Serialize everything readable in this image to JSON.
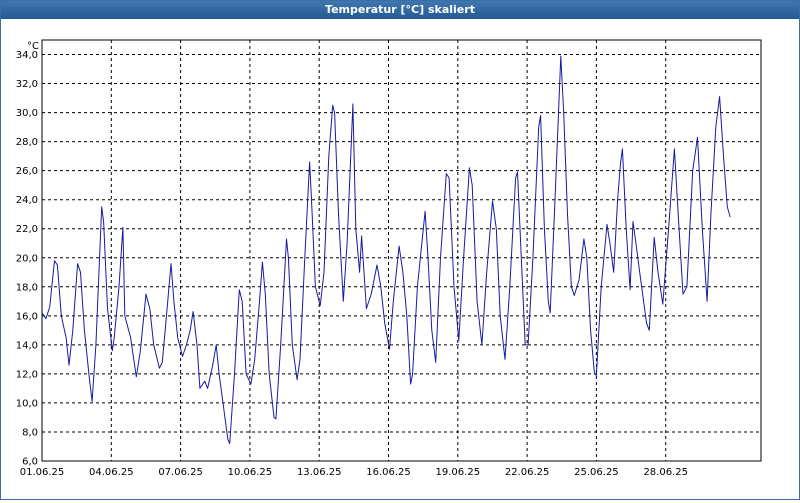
{
  "window": {
    "title": "Temperatur [°C] skaliert"
  },
  "chart_data": {
    "type": "line",
    "ylabel": "°C",
    "ylim": [
      6,
      35
    ],
    "xlim": [
      "2025-06-01",
      "2025-07-02T03:00"
    ],
    "y_ticks": [
      "6,0",
      "8,0",
      "10,0",
      "12,0",
      "14,0",
      "16,0",
      "18,0",
      "20,0",
      "22,0",
      "24,0",
      "26,0",
      "28,0",
      "30,0",
      "32,0",
      "34,0"
    ],
    "x_ticks": [
      "01.06.25",
      "04.06.25",
      "07.06.25",
      "10.06.25",
      "13.06.25",
      "16.06.25",
      "19.06.25",
      "22.06.25",
      "25.06.25",
      "28.06.25"
    ],
    "grid": true,
    "colors": {
      "line": "#1a1aa0",
      "grid": "#000000",
      "title_bar": "#2d64a0"
    },
    "series": [
      {
        "values": [
          [
            "2025-06-01T00:00",
            16.2
          ],
          [
            "2025-06-01T04:00",
            15.8
          ],
          [
            "2025-06-01T08:00",
            16.6
          ],
          [
            "2025-06-01T13:00",
            19.8
          ],
          [
            "2025-06-01T16:00",
            19.5
          ],
          [
            "2025-06-01T20:00",
            16.0
          ],
          [
            "2025-06-02T01:00",
            14.5
          ],
          [
            "2025-06-02T04:00",
            12.6
          ],
          [
            "2025-06-02T08:00",
            15.0
          ],
          [
            "2025-06-02T13:00",
            19.6
          ],
          [
            "2025-06-02T16:00",
            19.0
          ],
          [
            "2025-06-02T20:00",
            15.0
          ],
          [
            "2025-06-03T01:00",
            11.8
          ],
          [
            "2025-06-03T04:00",
            10.1
          ],
          [
            "2025-06-03T08:00",
            14.0
          ],
          [
            "2025-06-03T14:00",
            23.5
          ],
          [
            "2025-06-03T16:00",
            22.5
          ],
          [
            "2025-06-03T20:00",
            16.5
          ],
          [
            "2025-06-04T01:00",
            13.6
          ],
          [
            "2025-06-04T03:00",
            14.5
          ],
          [
            "2025-06-04T08:00",
            18.0
          ],
          [
            "2025-06-04T12:00",
            22.1
          ],
          [
            "2025-06-04T14:00",
            16.0
          ],
          [
            "2025-06-04T20:00",
            14.5
          ],
          [
            "2025-06-05T02:00",
            11.8
          ],
          [
            "2025-06-05T06:00",
            13.5
          ],
          [
            "2025-06-05T12:00",
            17.5
          ],
          [
            "2025-06-05T16:00",
            16.5
          ],
          [
            "2025-06-05T20:00",
            14.0
          ],
          [
            "2025-06-06T02:00",
            12.4
          ],
          [
            "2025-06-06T05:00",
            12.8
          ],
          [
            "2025-06-06T10:00",
            16.5
          ],
          [
            "2025-06-06T14:00",
            19.6
          ],
          [
            "2025-06-06T17:00",
            17.0
          ],
          [
            "2025-06-06T21:00",
            14.5
          ],
          [
            "2025-06-07T02:00",
            13.2
          ],
          [
            "2025-06-07T06:00",
            14.0
          ],
          [
            "2025-06-07T10:00",
            15.0
          ],
          [
            "2025-06-07T13:00",
            16.3
          ],
          [
            "2025-06-07T17:00",
            14.0
          ],
          [
            "2025-06-07T20:00",
            11.0
          ],
          [
            "2025-06-08T01:00",
            11.5
          ],
          [
            "2025-06-08T04:00",
            11.0
          ],
          [
            "2025-06-08T09:00",
            12.5
          ],
          [
            "2025-06-08T13:00",
            14.0
          ],
          [
            "2025-06-08T16:00",
            12.0
          ],
          [
            "2025-06-08T20:00",
            10.0
          ],
          [
            "2025-06-09T01:00",
            7.5
          ],
          [
            "2025-06-09T03:00",
            7.2
          ],
          [
            "2025-06-09T08:00",
            12.0
          ],
          [
            "2025-06-09T13:00",
            17.8
          ],
          [
            "2025-06-09T16:00",
            17.0
          ],
          [
            "2025-06-09T20:00",
            12.0
          ],
          [
            "2025-06-10T01:00",
            11.3
          ],
          [
            "2025-06-10T05:00",
            13.0
          ],
          [
            "2025-06-10T10:00",
            17.0
          ],
          [
            "2025-06-10T13:00",
            19.7
          ],
          [
            "2025-06-10T16:00",
            17.5
          ],
          [
            "2025-06-10T20:00",
            12.0
          ],
          [
            "2025-06-11T01:00",
            9.0
          ],
          [
            "2025-06-11T03:00",
            8.9
          ],
          [
            "2025-06-11T08:00",
            14.0
          ],
          [
            "2025-06-11T14:00",
            21.3
          ],
          [
            "2025-06-11T16:00",
            20.0
          ],
          [
            "2025-06-11T20:00",
            14.0
          ],
          [
            "2025-06-12T01:00",
            11.6
          ],
          [
            "2025-06-12T04:00",
            13.0
          ],
          [
            "2025-06-12T09:00",
            20.0
          ],
          [
            "2025-06-12T14:00",
            26.6
          ],
          [
            "2025-06-12T16:00",
            24.0
          ],
          [
            "2025-06-12T20:00",
            18.0
          ],
          [
            "2025-06-13T01:00",
            16.7
          ],
          [
            "2025-06-13T05:00",
            19.0
          ],
          [
            "2025-06-13T10:00",
            27.0
          ],
          [
            "2025-06-13T14:00",
            30.5
          ],
          [
            "2025-06-13T16:00",
            30.0
          ],
          [
            "2025-06-13T20:00",
            23.0
          ],
          [
            "2025-06-14T01:00",
            17.0
          ],
          [
            "2025-06-14T05:00",
            21.0
          ],
          [
            "2025-06-14T11:00",
            30.6
          ],
          [
            "2025-06-14T14:00",
            22.0
          ],
          [
            "2025-06-14T18:00",
            19.0
          ],
          [
            "2025-06-14T20:00",
            21.5
          ],
          [
            "2025-06-15T01:00",
            16.5
          ],
          [
            "2025-06-15T06:00",
            17.5
          ],
          [
            "2025-06-15T12:00",
            19.5
          ],
          [
            "2025-06-15T16:00",
            18.0
          ],
          [
            "2025-06-15T20:00",
            15.5
          ],
          [
            "2025-06-16T01:00",
            13.7
          ],
          [
            "2025-06-16T05:00",
            17.0
          ],
          [
            "2025-06-16T11:00",
            20.8
          ],
          [
            "2025-06-16T15:00",
            19.0
          ],
          [
            "2025-06-16T19:00",
            16.0
          ],
          [
            "2025-06-16T23:00",
            11.3
          ],
          [
            "2025-06-17T01:00",
            12.0
          ],
          [
            "2025-06-17T06:00",
            18.0
          ],
          [
            "2025-06-17T14:00",
            23.2
          ],
          [
            "2025-06-17T17:00",
            20.0
          ],
          [
            "2025-06-17T21:00",
            15.0
          ],
          [
            "2025-06-18T01:00",
            12.8
          ],
          [
            "2025-06-18T06:00",
            20.0
          ],
          [
            "2025-06-18T12:00",
            25.8
          ],
          [
            "2025-06-18T15:00",
            25.5
          ],
          [
            "2025-06-18T20:00",
            18.0
          ],
          [
            "2025-06-19T01:00",
            14.3
          ],
          [
            "2025-06-19T06:00",
            20.0
          ],
          [
            "2025-06-19T12:00",
            26.2
          ],
          [
            "2025-06-19T15:00",
            25.0
          ],
          [
            "2025-06-19T20:00",
            17.0
          ],
          [
            "2025-06-20T01:00",
            14.0
          ],
          [
            "2025-06-20T06:00",
            19.0
          ],
          [
            "2025-06-20T12:00",
            23.9
          ],
          [
            "2025-06-20T16:00",
            22.0
          ],
          [
            "2025-06-20T20:00",
            16.0
          ],
          [
            "2025-06-21T01:00",
            13.0
          ],
          [
            "2025-06-21T06:00",
            18.0
          ],
          [
            "2025-06-21T12:00",
            25.5
          ],
          [
            "2025-06-21T14:00",
            25.9
          ],
          [
            "2025-06-21T18:00",
            20.0
          ],
          [
            "2025-06-21T22:00",
            14.0
          ],
          [
            "2025-06-22T01:00",
            14.0
          ],
          [
            "2025-06-22T06:00",
            20.0
          ],
          [
            "2025-06-22T12:00",
            29.0
          ],
          [
            "2025-06-22T14:00",
            29.8
          ],
          [
            "2025-06-22T18:00",
            22.0
          ],
          [
            "2025-06-22T22:00",
            17.0
          ],
          [
            "2025-06-23T00:00",
            16.2
          ],
          [
            "2025-06-23T05:00",
            24.0
          ],
          [
            "2025-06-23T11:00",
            33.9
          ],
          [
            "2025-06-23T14:00",
            30.0
          ],
          [
            "2025-06-23T18:00",
            23.0
          ],
          [
            "2025-06-23T22:00",
            18.0
          ],
          [
            "2025-06-24T01:00",
            17.4
          ],
          [
            "2025-06-24T06:00",
            18.5
          ],
          [
            "2025-06-24T11:00",
            21.3
          ],
          [
            "2025-06-24T14:00",
            20.0
          ],
          [
            "2025-06-24T18:00",
            15.0
          ],
          [
            "2025-06-24T22:00",
            12.0
          ],
          [
            "2025-06-25T00:00",
            11.9
          ],
          [
            "2025-06-25T05:00",
            18.0
          ],
          [
            "2025-06-25T11:00",
            22.3
          ],
          [
            "2025-06-25T14:00",
            21.0
          ],
          [
            "2025-06-25T18:00",
            19.0
          ],
          [
            "2025-06-25T22:00",
            24.0
          ],
          [
            "2025-06-26T01:00",
            26.5
          ],
          [
            "2025-06-26T03:00",
            27.5
          ],
          [
            "2025-06-26T07:00",
            22.0
          ],
          [
            "2025-06-26T11:00",
            17.8
          ],
          [
            "2025-06-26T14:00",
            22.5
          ],
          [
            "2025-06-26T17:00",
            21.0
          ],
          [
            "2025-06-26T21:00",
            19.0
          ],
          [
            "2025-06-27T01:00",
            17.0
          ],
          [
            "2025-06-27T04:00",
            15.5
          ],
          [
            "2025-06-27T07:00",
            15.0
          ],
          [
            "2025-06-27T12:00",
            21.4
          ],
          [
            "2025-06-27T16:00",
            19.0
          ],
          [
            "2025-06-27T21:00",
            16.8
          ],
          [
            "2025-06-28T03:00",
            22.0
          ],
          [
            "2025-06-28T09:00",
            27.5
          ],
          [
            "2025-06-28T13:00",
            23.0
          ],
          [
            "2025-06-28T18:00",
            17.5
          ],
          [
            "2025-06-28T22:00",
            18.0
          ],
          [
            "2025-06-29T04:00",
            26.0
          ],
          [
            "2025-06-29T09:00",
            28.3
          ],
          [
            "2025-06-29T14:00",
            22.0
          ],
          [
            "2025-06-29T19:00",
            17.0
          ],
          [
            "2025-06-29T23:00",
            23.0
          ],
          [
            "2025-06-30T04:00",
            29.0
          ],
          [
            "2025-06-30T08:00",
            31.1
          ],
          [
            "2025-06-30T12:00",
            27.0
          ],
          [
            "2025-06-30T16:00",
            23.5
          ],
          [
            "2025-06-30T19:00",
            22.8
          ]
        ]
      }
    ]
  }
}
